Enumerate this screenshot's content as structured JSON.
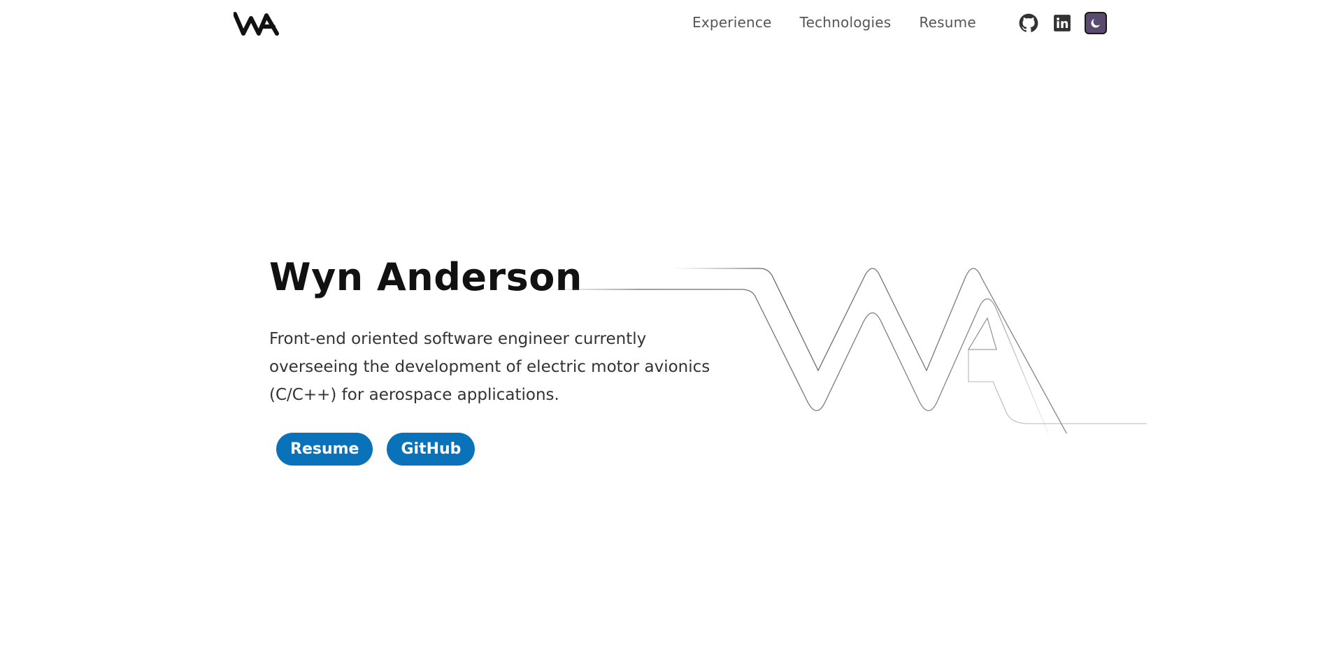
{
  "header": {
    "logo_name": "WA",
    "nav": [
      {
        "label": "Experience"
      },
      {
        "label": "Technologies"
      },
      {
        "label": "Resume"
      }
    ],
    "social_icons": [
      "github-icon",
      "linkedin-icon"
    ],
    "theme_toggle_icon": "moon-icon"
  },
  "hero": {
    "name": "Wyn Anderson",
    "description": "Front-end oriented software engineer currently overseeing the development of electric motor avionics (C/C++) for aerospace applications.",
    "buttons": [
      {
        "label": "Resume"
      },
      {
        "label": "GitHub"
      }
    ]
  },
  "colors": {
    "accent": "#0a72b8",
    "toggle_bg": "#5a4a6e",
    "text": "#111111",
    "nav_text": "#555555"
  }
}
